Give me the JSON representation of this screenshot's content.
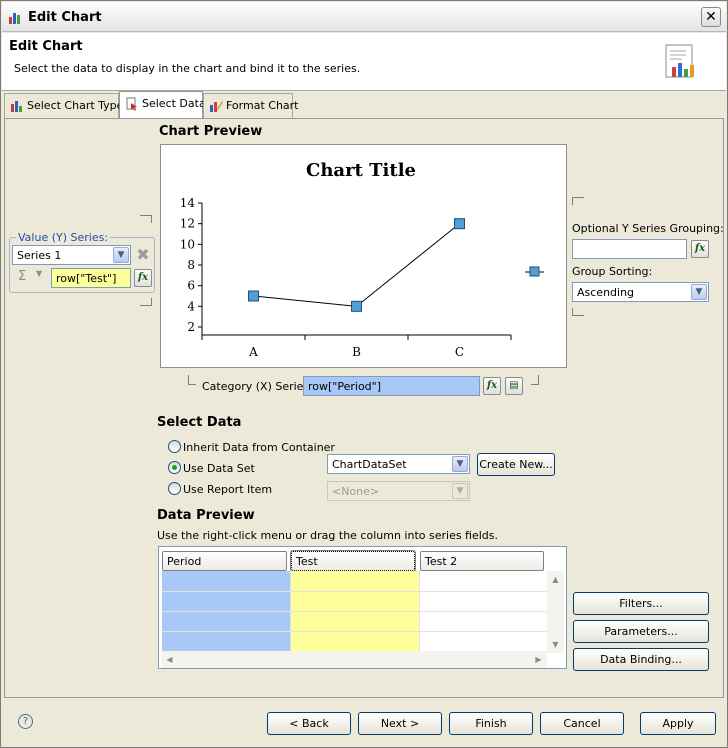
{
  "window": {
    "title": "Edit Chart"
  },
  "header": {
    "title": "Edit Chart",
    "description": "Select the data to display in the chart and bind it to the series."
  },
  "tabs": [
    {
      "label": "Select Chart Type"
    },
    {
      "label": "Select Data"
    },
    {
      "label": "Format Chart"
    }
  ],
  "chart_preview": {
    "heading": "Chart Preview"
  },
  "chart_data": {
    "type": "line",
    "title": "Chart Title",
    "categories": [
      "A",
      "B",
      "C"
    ],
    "series": [
      {
        "values": [
          5,
          4,
          12
        ]
      }
    ],
    "y_ticks": [
      "14",
      "12",
      "10",
      "8",
      "6",
      "4",
      "2"
    ],
    "ylim": [
      2,
      14
    ],
    "xlabel": "",
    "ylabel": "",
    "legend": "right"
  },
  "value_series": {
    "label": "Value (Y) Series:",
    "series_select": "Series 1",
    "sigma": "Σ",
    "expression": "row[\"Test\"]"
  },
  "grouping": {
    "optional_label": "Optional Y Series Grouping:",
    "optional_value": "",
    "sorting_label": "Group Sorting:",
    "sorting_value": "Ascending"
  },
  "category_series": {
    "label": "Category (X) Series:",
    "expression": "row[\"Period\"]"
  },
  "select_data": {
    "heading": "Select Data",
    "options": [
      {
        "label": "Inherit Data from Container",
        "checked": false
      },
      {
        "label": "Use Data Set",
        "checked": true
      },
      {
        "label": "Use Report Item",
        "checked": false
      }
    ],
    "dataset_value": "ChartDataSet",
    "report_item_value": "<None>",
    "create_new": "Create New..."
  },
  "data_preview": {
    "heading": "Data Preview",
    "hint": "Use the right-click menu or drag the column into series fields.",
    "columns": [
      "Period",
      "Test",
      "Test 2"
    ]
  },
  "side_buttons": {
    "filters": "Filters...",
    "parameters": "Parameters...",
    "data_binding": "Data Binding..."
  },
  "footer": {
    "help": "?",
    "back": "< Back",
    "next": "Next >",
    "finish": "Finish",
    "cancel": "Cancel",
    "apply": "Apply"
  },
  "colors": {
    "marker_fill": "#4f9fd8",
    "value_cell": "#ffff99",
    "category_cell": "#a8c8f8",
    "series_label": "#1f4fa8"
  }
}
